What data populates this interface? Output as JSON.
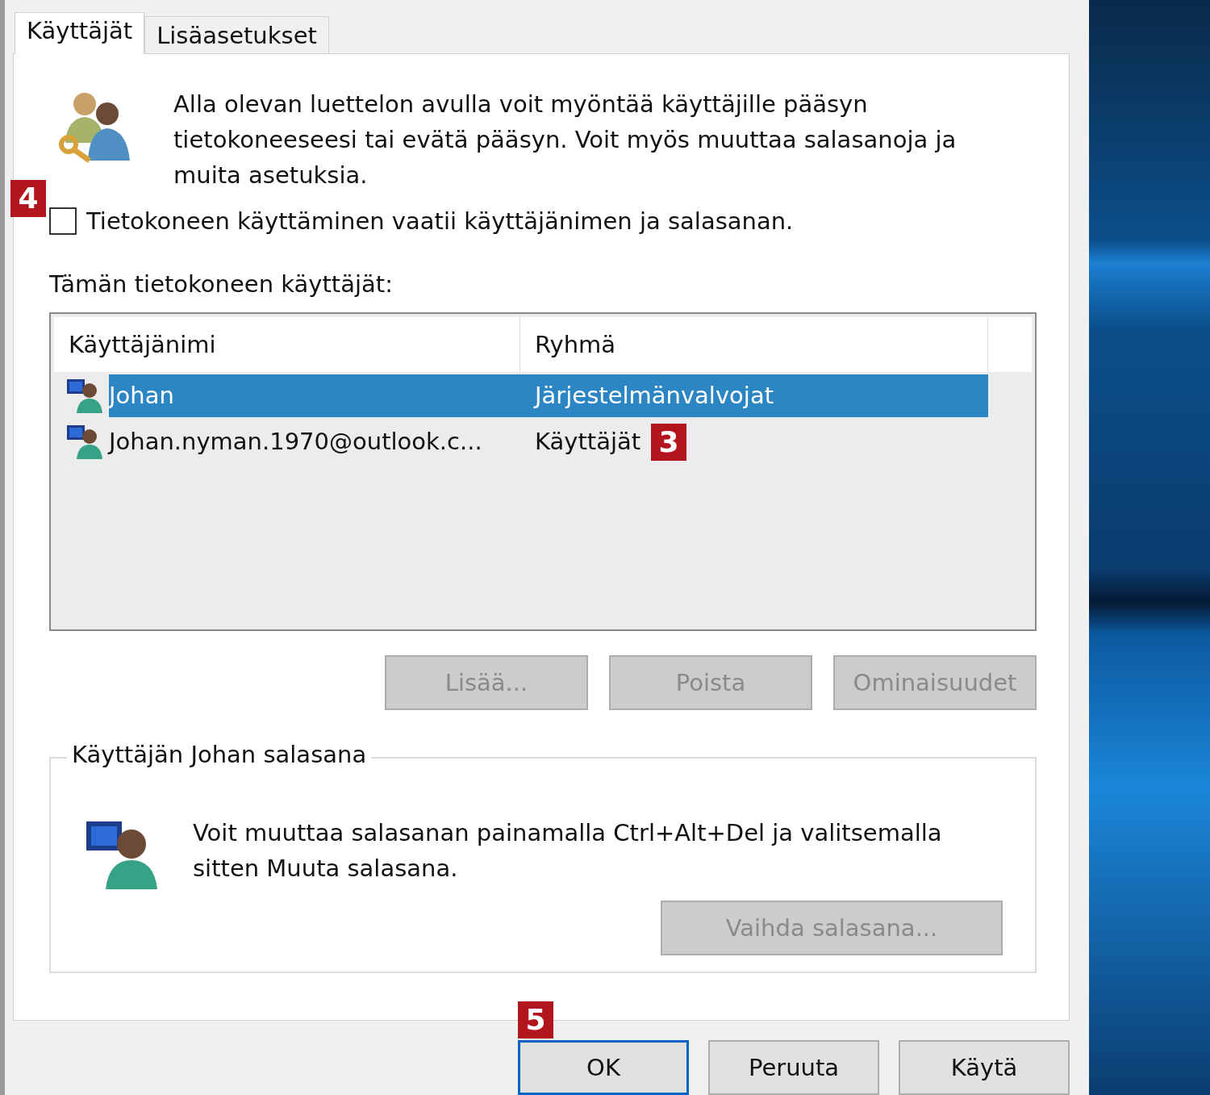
{
  "tabs": [
    {
      "label": "Käyttäjät",
      "selected": true
    },
    {
      "label": "Lisäasetukset",
      "selected": false
    }
  ],
  "intro": "Alla olevan luettelon avulla voit myöntää käyttäjille pääsyn tietokoneeseesi tai evätä pääsyn. Voit myös muuttaa salasanoja ja muita asetuksia.",
  "require_password": {
    "label": "Tietokoneen käyttäminen vaatii käyttäjänimen ja salasanan.",
    "checked": false,
    "callout": "4"
  },
  "users_label": "Tämän tietokoneen käyttäjät:",
  "users_table": {
    "columns": [
      "Käyttäjänimi",
      "Ryhmä"
    ],
    "rows": [
      {
        "username": "Johan",
        "group": "Järjestelmänvalvojat",
        "selected": true
      },
      {
        "username": "Johan.nyman.1970@outlook.c...",
        "group": "Käyttäjät",
        "selected": false,
        "callout": "3"
      }
    ]
  },
  "list_buttons": [
    {
      "label": "Lisää...",
      "disabled": true
    },
    {
      "label": "Poista",
      "disabled": true
    },
    {
      "label": "Ominaisuudet",
      "disabled": true
    }
  ],
  "password_group": {
    "title": "Käyttäjän Johan salasana",
    "text": "Voit muuttaa salasanan painamalla Ctrl+Alt+Del ja valitsemalla sitten Muuta salasana.",
    "button": {
      "label": "Vaihda salasana...",
      "disabled": true
    }
  },
  "dialog_buttons": [
    {
      "label": "OK",
      "default": true,
      "callout": "5"
    },
    {
      "label": "Peruuta",
      "default": false
    },
    {
      "label": "Käytä",
      "default": false
    }
  ]
}
